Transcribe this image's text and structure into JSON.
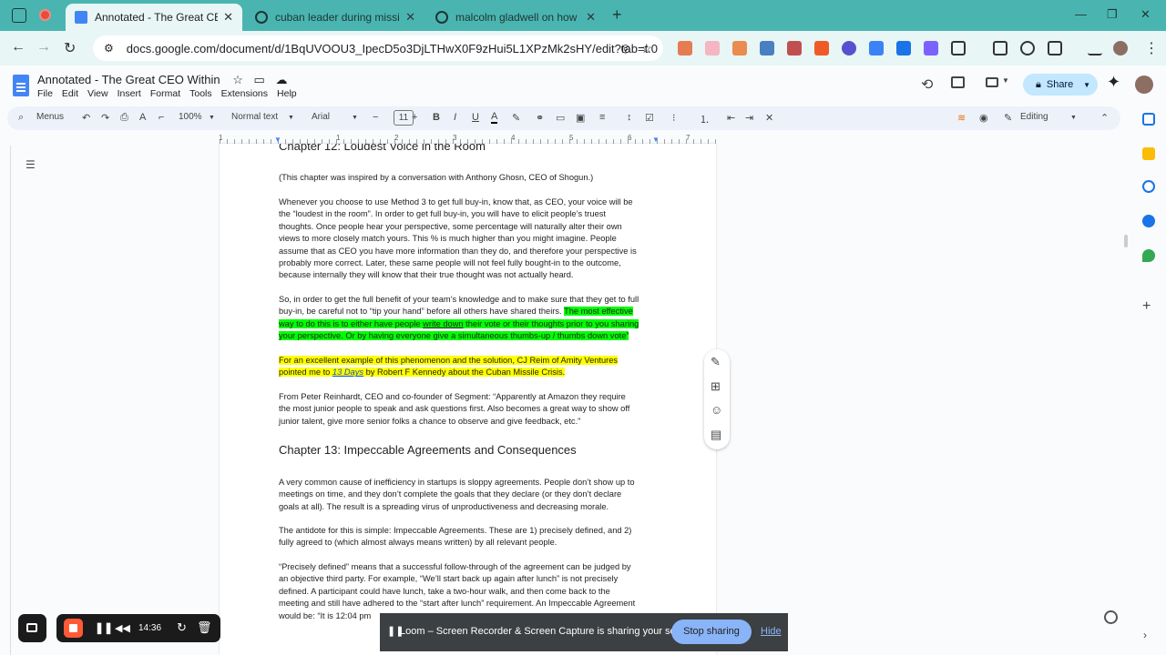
{
  "browser": {
    "tabs": [
      {
        "title": "Annotated - The Great CEO Within",
        "active": true
      },
      {
        "title": "cuban leader during missile crisis",
        "active": false
      },
      {
        "title": "malcolm gladwell on how many",
        "active": false
      }
    ],
    "url": "docs.google.com/document/d/1BqUVOOU3_IpecD5o3DjLTHwX0F9zHui5L1XPzMk2sHY/edit?tab=t.0"
  },
  "doc": {
    "title": "Annotated - The Great CEO Within",
    "menu": [
      "File",
      "Edit",
      "View",
      "Insert",
      "Format",
      "Tools",
      "Extensions",
      "Help"
    ],
    "share_label": "Share"
  },
  "toolbar": {
    "menus": "Menus",
    "zoom": "100%",
    "style": "Normal text",
    "font": "Arial",
    "size": "11",
    "mode": "Editing"
  },
  "ruler": [
    "1",
    "1",
    "2",
    "3",
    "4",
    "5",
    "6",
    "7"
  ],
  "content": {
    "chapter12_title": "Chapter 12: Loudest Voice in the Room",
    "p1": "(This chapter was inspired by a conversation with Anthony Ghosn, CEO of Shogun.)",
    "p2": [
      "Whenever you choose to use Method 3 to get full buy-in, know that, as CEO, your voice will be",
      "the “loudest in the room”.  In order to get full buy-in, you will have to elicit people’s truest",
      "thoughts.  Once people hear your perspective, some percentage will naturally alter their own",
      "views to more closely match yours.  This % is much higher than you might imagine. People",
      "assume that as CEO you have more information than they do, and therefore your perspective is",
      "probably more correct.  Later, these same people will not feel fully bought-in to the outcome,",
      "because internally they will know that their true thought was not actually heard."
    ],
    "p3_line1": "So, in order to get the full benefit of your team’s knowledge and to make sure that they get to full",
    "p3_line2_plain": "buy-in, be careful not to “tip your hand” before all others have shared theirs.  ",
    "p3_line2_hl": "The most effective",
    "p3_line3_a": "way to do this is to either have people ",
    "p3_line3_u": "write down",
    "p3_line3_b": " their vote or their thoughts prior to you sharing",
    "p3_line4": "your perspective. Or by having everyone give a simultaneous thumbs-up / thumbs down vote”",
    "p4_line1": "For an excellent example of this phenomenon and the solution, CJ Reim of Amity Ventures",
    "p4_line2_a": "pointed me to ",
    "p4_line2_link": "13 Days",
    "p4_line2_b": " by Robert F Kennedy about the Cuban Missile Crisis.",
    "p5": [
      "From Peter Reinhardt, CEO and co-founder of Segment:  “Apparently at Amazon they require",
      "the most junior people to speak and ask questions first. Also becomes a great way to show off",
      "junior talent, give more senior folks a chance to observe and give feedback, etc.”"
    ],
    "chapter13_title": "Chapter 13: Impeccable Agreements and Consequences",
    "p6": [
      "A very common cause of inefficiency in startups is sloppy agreements. People don’t show up to",
      "meetings on time, and they don’t complete the goals that they declare (or they don’t declare",
      "goals at all). The result is a spreading virus of unproductiveness and decreasing morale."
    ],
    "p7": [
      "The antidote for this is simple: Impeccable Agreements. These are 1) precisely defined, and 2)",
      "fully agreed to (which almost always means written) by all relevant people."
    ],
    "p8": [
      "“Precisely defined” means that a successful follow-through of the agreement can be judged by",
      "an objective third party.  For example, “We’ll start back up again after lunch” is not precisely",
      "defined. A participant could have lunch, take a two-hour walk, and then come back to the",
      "meeting and still have adhered to the “start after lunch” requirement. An Impeccable Agreement",
      "would be: “It is 12:04 pm"
    ]
  },
  "loom": {
    "timer": "14:36",
    "share_message": "Loom – Screen Recorder & Screen Capture is sharing your screen.",
    "stop_label": "Stop sharing",
    "hide_label": "Hide"
  },
  "colors": {
    "tabbar": "#4ab5b0",
    "highlight_green": "#00ff00",
    "highlight_yellow": "#ffff00",
    "share_button": "#c2e7ff"
  }
}
